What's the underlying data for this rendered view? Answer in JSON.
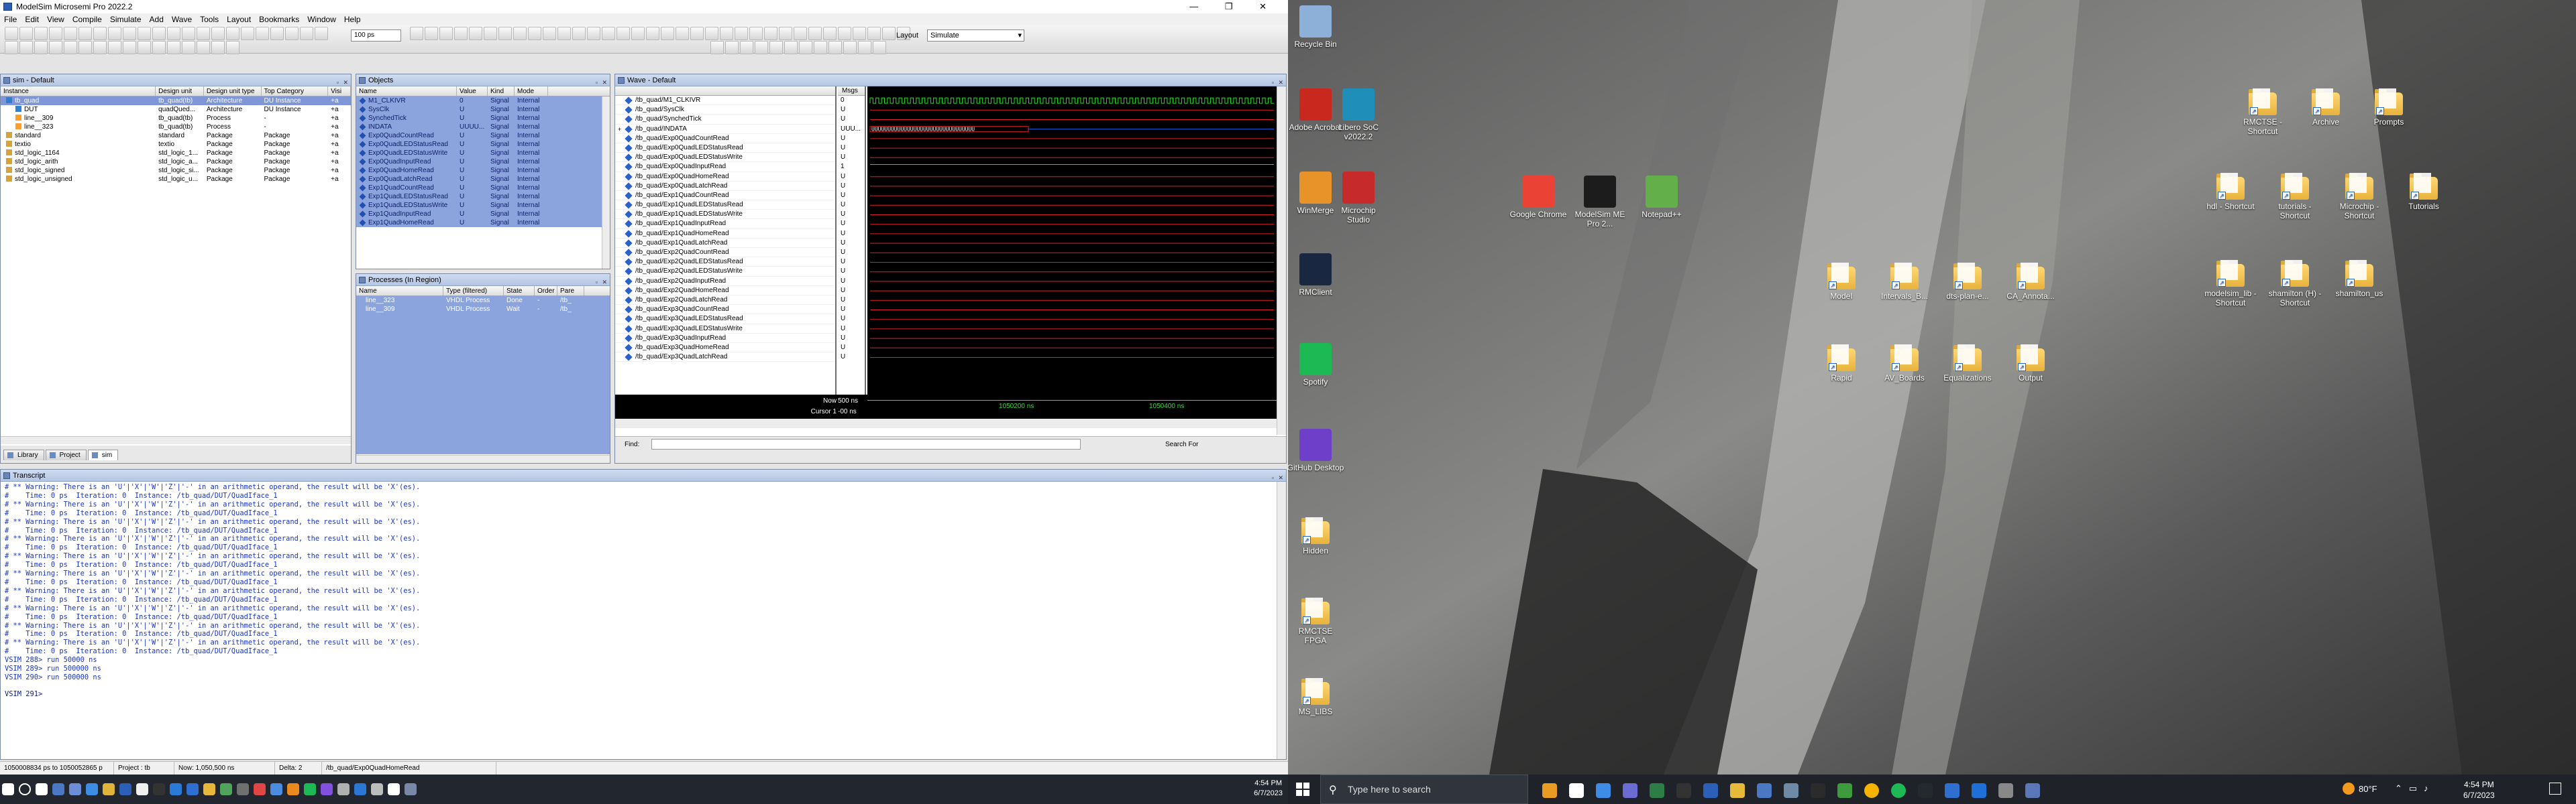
{
  "window": {
    "title": "ModelSim Microsemi Pro 2022.2",
    "controls": "—  ❐  ✕"
  },
  "menu": [
    "File",
    "Edit",
    "View",
    "Compile",
    "Simulate",
    "Add",
    "Wave",
    "Tools",
    "Layout",
    "Bookmarks",
    "Window",
    "Help"
  ],
  "toolbar": {
    "step_value": "100 ps",
    "layout_label": "Layout",
    "layout_value": "Simulate"
  },
  "sim_pane": {
    "title": "sim - Default",
    "columns": [
      "Instance",
      "Design unit",
      "Design unit type",
      "Top Category",
      "Visi"
    ],
    "rows": [
      [
        "tb_quad",
        "tb_quad(tb)",
        "Architecture",
        "DU Instance",
        "+a"
      ],
      [
        "DUT",
        "quadQued...",
        "Architecture",
        "DU Instance",
        "+a"
      ],
      [
        "line__309",
        "tb_quad(tb)",
        "Process",
        "-",
        "+a"
      ],
      [
        "line__323",
        "tb_quad(tb)",
        "Process",
        "-",
        "+a"
      ],
      [
        "standard",
        "standard",
        "Package",
        "Package",
        "+a"
      ],
      [
        "textio",
        "textio",
        "Package",
        "Package",
        "+a"
      ],
      [
        "std_logic_1164",
        "std_logic_1...",
        "Package",
        "Package",
        "+a"
      ],
      [
        "std_logic_arith",
        "std_logic_a...",
        "Package",
        "Package",
        "+a"
      ],
      [
        "std_logic_signed",
        "std_logic_si...",
        "Package",
        "Package",
        "+a"
      ],
      [
        "std_logic_unsigned",
        "std_logic_u...",
        "Package",
        "Package",
        "+a"
      ]
    ],
    "tabs": [
      "Library",
      "Project",
      "sim"
    ]
  },
  "objects_pane": {
    "title": "Objects",
    "columns": [
      "Name",
      "Value",
      "Kind",
      "Mode"
    ],
    "rows": [
      [
        "M1_CLKIVR",
        "0",
        "Signal",
        "Internal"
      ],
      [
        "SysClk",
        "U",
        "Signal",
        "Internal"
      ],
      [
        "SynchedTick",
        "U",
        "Signal",
        "Internal"
      ],
      [
        "INDATA",
        "UUUU...",
        "Signal",
        "Internal"
      ],
      [
        "Exp0QuadCountRead",
        "U",
        "Signal",
        "Internal"
      ],
      [
        "Exp0QuadLEDStatusRead",
        "U",
        "Signal",
        "Internal"
      ],
      [
        "Exp0QuadLEDStatusWrite",
        "U",
        "Signal",
        "Internal"
      ],
      [
        "Exp0QuadInputRead",
        "U",
        "Signal",
        "Internal"
      ],
      [
        "Exp0QuadHomeRead",
        "U",
        "Signal",
        "Internal"
      ],
      [
        "Exp0QuadLatchRead",
        "U",
        "Signal",
        "Internal"
      ],
      [
        "Exp1QuadCountRead",
        "U",
        "Signal",
        "Internal"
      ],
      [
        "Exp1QuadLEDStatusRead",
        "U",
        "Signal",
        "Internal"
      ],
      [
        "Exp1QuadLEDStatusWrite",
        "U",
        "Signal",
        "Internal"
      ],
      [
        "Exp1QuadInputRead",
        "U",
        "Signal",
        "Internal"
      ],
      [
        "Exp1QuadHomeRead",
        "U",
        "Signal",
        "Internal"
      ]
    ]
  },
  "processes_pane": {
    "title": "Processes (In Region)",
    "columns": [
      "Name",
      "Type (filtered)",
      "State",
      "Order",
      "Pare"
    ],
    "rows": [
      [
        "line__323",
        "VHDL Process",
        "Done",
        "-",
        "/tb_"
      ],
      [
        "line__309",
        "VHDL Process",
        "Wait",
        "-",
        "/tb_"
      ]
    ]
  },
  "wave_pane": {
    "title": "Wave - Default",
    "msgs_label": "Msgs",
    "signals": [
      [
        "/tb_quad/M1_CLKIVR",
        "0"
      ],
      [
        "/tb_quad/SysClk",
        "U"
      ],
      [
        "/tb_quad/SynchedTick",
        "U"
      ],
      [
        "/tb_quad/INDATA",
        "UUU..."
      ],
      [
        "/tb_quad/Exp0QuadCountRead",
        "U"
      ],
      [
        "/tb_quad/Exp0QuadLEDStatusRead",
        "U"
      ],
      [
        "/tb_quad/Exp0QuadLEDStatusWrite",
        "U"
      ],
      [
        "/tb_quad/Exp0QuadInputRead",
        "1"
      ],
      [
        "/tb_quad/Exp0QuadHomeRead",
        "U"
      ],
      [
        "/tb_quad/Exp0QuadLatchRead",
        "U"
      ],
      [
        "/tb_quad/Exp1QuadCountRead",
        "U"
      ],
      [
        "/tb_quad/Exp1QuadLEDStatusRead",
        "U"
      ],
      [
        "/tb_quad/Exp1QuadLEDStatusWrite",
        "U"
      ],
      [
        "/tb_quad/Exp1QuadInputRead",
        "U"
      ],
      [
        "/tb_quad/Exp1QuadHomeRead",
        "U"
      ],
      [
        "/tb_quad/Exp1QuadLatchRead",
        "U"
      ],
      [
        "/tb_quad/Exp2QuadCountRead",
        "U"
      ],
      [
        "/tb_quad/Exp2QuadLEDStatusRead",
        "U"
      ],
      [
        "/tb_quad/Exp2QuadLEDStatusWrite",
        "U"
      ],
      [
        "/tb_quad/Exp2QuadInputRead",
        "U"
      ],
      [
        "/tb_quad/Exp2QuadHomeRead",
        "U"
      ],
      [
        "/tb_quad/Exp2QuadLatchRead",
        "U"
      ],
      [
        "/tb_quad/Exp3QuadCountRead",
        "U"
      ],
      [
        "/tb_quad/Exp3QuadLEDStatusRead",
        "U"
      ],
      [
        "/tb_quad/Exp3QuadLEDStatusWrite",
        "U"
      ],
      [
        "/tb_quad/Exp3QuadInputRead",
        "U"
      ],
      [
        "/tb_quad/Exp3QuadHomeRead",
        "U"
      ],
      [
        "/tb_quad/Exp3QuadLatchRead",
        "U"
      ]
    ],
    "indata_wave": "UUUUUUUUUUUUUUUUUUUUUUUUUUUUUUUU",
    "now_label": "Now",
    "now_value": "500 ns",
    "cursor_label": "Cursor 1",
    "cursor_value": "-00 ns",
    "ticks": [
      "1050200 ns",
      "1050400 ns"
    ],
    "find_label": "Find:",
    "search_label": "Search For"
  },
  "transcript": {
    "title": "Transcript",
    "warning": "# ** Warning: There is an 'U'|'X'|'W'|'Z'|'-' in an arithmetic operand, the result will be 'X'(es).",
    "time": "#    Time: 0 ps  Iteration: 0  Instance: /tb_quad/DUT/QuadIface_1",
    "commands": [
      "VSIM 288> run 50000 ns",
      "VSIM 289> run 500000 ns",
      "VSIM 290> run 500000 ns"
    ],
    "prompt": "VSIM 291>"
  },
  "status": {
    "cells": [
      "1050008834 ps to 1050052865 p",
      "Project : tb",
      "Now: 1,050,500 ns",
      "Delta: 2",
      "/tb_quad/Exp0QuadHomeRead"
    ]
  },
  "taskbar": {
    "search_placeholder": "Type here to search",
    "weather": "80°F",
    "time": "4:54 PM",
    "date": "6/7/2023"
  },
  "desktop": {
    "icons_left": [
      "Recycle Bin",
      "Adobe Acrobat",
      "Libero SoC v2022.2",
      "WinMerge",
      "Microchip Studio",
      "RMClient",
      "Spotify",
      "GitHub Desktop",
      "Hidden",
      "RMCTSE FPGA",
      "MS_LIBS"
    ],
    "icons_mid": [
      "Google Chrome",
      "ModelSim ME Pro 2...",
      "Notepad++"
    ],
    "folders_mid": [
      "ModeI",
      "Intervals_B...",
      "dts-plan-e...",
      "CA_Annota...",
      "Rapid",
      "AV_Boards",
      "Equalizations",
      "Output"
    ],
    "folders_right": [
      "RMCTSE - Shortcut",
      "Archive",
      "Prompts",
      "hdl - Shortcut",
      "tutorials - Shortcut",
      "Microchip - Shortcut",
      "Tutorials",
      "modelsim_lib - Shortcut",
      "shamilton (H) - Shortcut",
      "shamilton_us"
    ]
  }
}
